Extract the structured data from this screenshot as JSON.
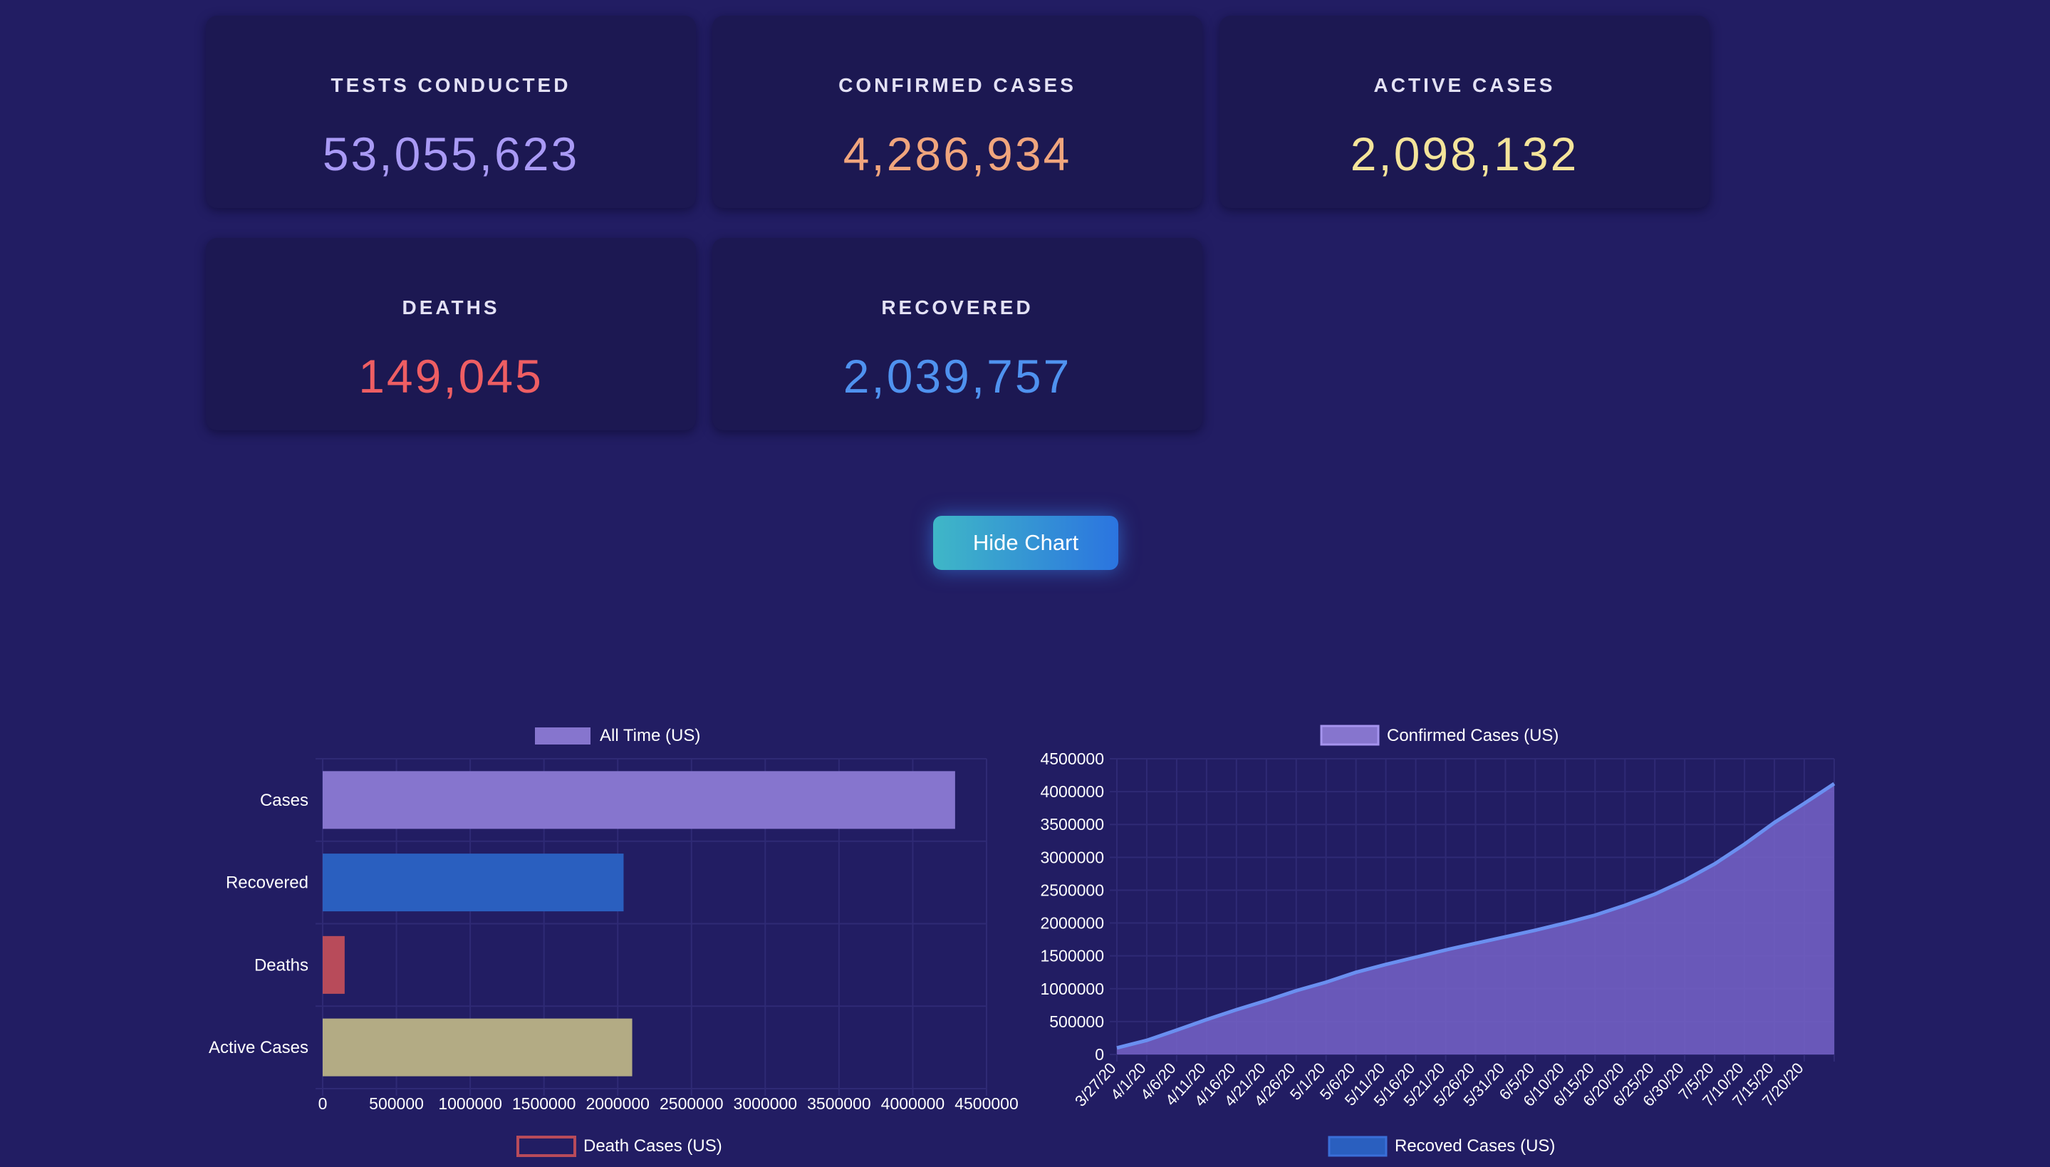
{
  "stats": {
    "tests": {
      "label": "TESTS CONDUCTED",
      "value": "53,055,623",
      "color": "#a99af5"
    },
    "confirmed": {
      "label": "CONFIRMED CASES",
      "value": "4,286,934",
      "color": "#f0a57d"
    },
    "active": {
      "label": "ACTIVE CASES",
      "value": "2,098,132",
      "color": "#f4e49a"
    },
    "deaths": {
      "label": "DEATHS",
      "value": "149,045",
      "color": "#ee5e63"
    },
    "recovered": {
      "label": "RECOVERED",
      "value": "2,039,757",
      "color": "#4f92ef"
    }
  },
  "toggle_label": "Hide Chart",
  "bottom_legends": {
    "deaths": "Death Cases (US)",
    "recovered": "Recoved Cases (US)"
  },
  "chart_data": [
    {
      "type": "bar",
      "orientation": "horizontal",
      "legend": "All Time (US)",
      "categories": [
        "Cases",
        "Recovered",
        "Deaths",
        "Active Cases"
      ],
      "values": [
        4286934,
        2039757,
        149045,
        2098132
      ],
      "colors": [
        "#8675ce",
        "#2a5fbf",
        "#b84b5a",
        "#b3ab84"
      ],
      "xlim": [
        0,
        4500000
      ],
      "xticks": [
        0,
        500000,
        1000000,
        1500000,
        2000000,
        2500000,
        3000000,
        3500000,
        4000000,
        4500000
      ],
      "grid": true
    },
    {
      "type": "area",
      "legend": "Confirmed Cases (US)",
      "x": [
        "3/27/20",
        "4/1/20",
        "4/6/20",
        "4/11/20",
        "4/16/20",
        "4/21/20",
        "4/26/20",
        "5/1/20",
        "5/6/20",
        "5/11/20",
        "5/16/20",
        "5/21/20",
        "5/26/20",
        "5/31/20",
        "6/5/20",
        "6/10/20",
        "6/15/20",
        "6/20/20",
        "6/25/20",
        "6/30/20",
        "7/5/20",
        "7/10/20",
        "7/15/20",
        "7/20/20",
        "7/25/20"
      ],
      "x_tick_labels": [
        "3/27/20",
        "4/1/20",
        "4/6/20",
        "4/11/20",
        "4/16/20",
        "4/21/20",
        "4/26/20",
        "5/1/20",
        "5/6/20",
        "5/11/20",
        "5/16/20",
        "5/21/20",
        "5/26/20",
        "5/31/20",
        "6/5/20",
        "6/10/20",
        "6/15/20",
        "6/20/20",
        "6/25/20",
        "6/30/20",
        "7/5/20",
        "7/10/20",
        "7/15/20",
        "7/20/20"
      ],
      "y": [
        100000,
        215000,
        370000,
        530000,
        680000,
        820000,
        970000,
        1100000,
        1250000,
        1370000,
        1480000,
        1590000,
        1690000,
        1790000,
        1890000,
        2000000,
        2120000,
        2270000,
        2440000,
        2650000,
        2900000,
        3200000,
        3530000,
        3820000,
        4120000
      ],
      "ylim": [
        0,
        4500000
      ],
      "yticks": [
        0,
        500000,
        1000000,
        1500000,
        2000000,
        2500000,
        3000000,
        3500000,
        4000000,
        4500000
      ],
      "line_color": "#6a8ff0",
      "fill_color": "#7563c8",
      "grid": true
    }
  ]
}
